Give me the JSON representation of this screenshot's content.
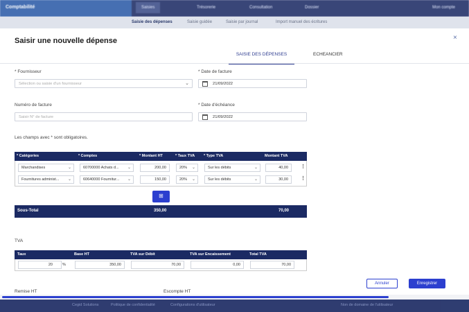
{
  "background": {
    "brand": "Comptabilité",
    "nav": [
      "Saisies",
      "Trésorerie",
      "Consultation",
      "Dossier"
    ],
    "user": "Mon compte",
    "subnav": [
      "Saisie des dépenses",
      "Saisie guidée",
      "Saisie par journal",
      "Import manuel des écritures"
    ],
    "footer": [
      "Cegid Solutions",
      "Politique de confidentialité",
      "Configurations d'utilisateur",
      "Non de domaine de l'utilisateur"
    ]
  },
  "modal": {
    "title": "Saisir une nouvelle dépense",
    "close": "×",
    "tabs": [
      "SAISIE DES DÉPENSES",
      "ECHEANCIER"
    ],
    "fournisseur_label": "* Fournisseur",
    "fournisseur_placeholder": "Sélection ou saisie d'un fournisseur",
    "date_facture_label": "* Date de facture",
    "date_facture": "21/09/2022",
    "numero_label": "Numéro de facture",
    "numero_placeholder": "Saisir N° de facture",
    "date_echeance_label": "* Date d'échéance",
    "date_echeance": "21/09/2022",
    "required_note": "Les champs avec * sont obligatoires."
  },
  "lines_table": {
    "headers": [
      "* Catégories",
      "* Comptes",
      "* Montant HT",
      "* Taux TVA",
      "* Type TVA",
      "Montant TVA"
    ],
    "rows": [
      {
        "categorie": "Marchandises",
        "compte": "60700000 Achats d...",
        "montant_ht": "200,00",
        "taux": "20%",
        "type": "Sur les débits",
        "montant_tva": "40,00"
      },
      {
        "categorie": "Fournitures administ...",
        "compte": "60640000 Fournitur...",
        "montant_ht": "150,00",
        "taux": "20%",
        "type": "Sur les débits",
        "montant_tva": "30,00"
      }
    ],
    "subtotal_label": "Sous-Total",
    "subtotal_ht": "350,00",
    "subtotal_tva": "70,00"
  },
  "tva": {
    "label": "TVA",
    "headers": [
      "Taux",
      "Base HT",
      "TVA sur Débit",
      "TVA sur Encaissement",
      "Total TVA"
    ],
    "row": {
      "taux": "20",
      "unit": "%",
      "base": "350,00",
      "debit": "70,00",
      "encaissement": "0,00",
      "total": "70,00"
    }
  },
  "buttons": {
    "cancel": "Annuler",
    "save": "Enregistrer"
  },
  "bottom": {
    "remise": "Remise HT",
    "escompte": "Escompte HT"
  },
  "colors": {
    "navy": "#1b2a63",
    "accent": "#2c3fcf"
  }
}
